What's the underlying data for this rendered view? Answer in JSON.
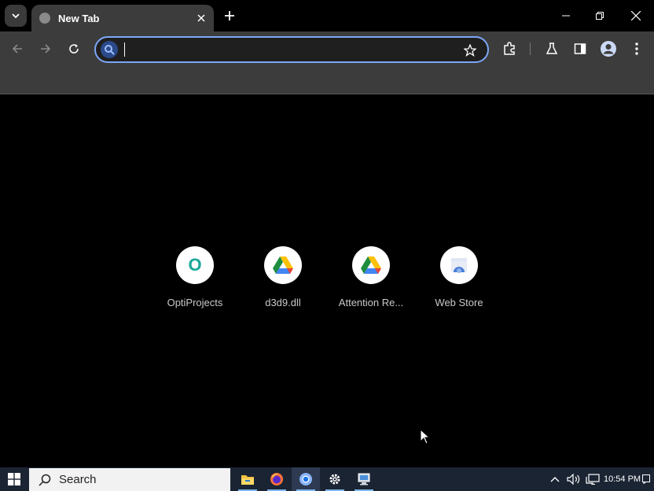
{
  "browser": {
    "tab": {
      "title": "New Tab"
    },
    "omnibox": {
      "value": "",
      "placeholder": ""
    }
  },
  "shortcuts": [
    {
      "label": "OptiProjects",
      "icon": "optiprojects-icon",
      "letter": "O"
    },
    {
      "label": "d3d9.dll",
      "icon": "google-drive-icon"
    },
    {
      "label": "Attention Re...",
      "icon": "google-drive-icon"
    },
    {
      "label": "Web Store",
      "icon": "web-store-icon"
    }
  ],
  "taskbar": {
    "search_label": "Search",
    "clock": "10:54 PM",
    "apps": [
      "file-explorer-icon",
      "firefox-icon",
      "chrome-icon",
      "settings-icon",
      "remote-desktop-icon"
    ]
  },
  "colors": {
    "accent": "#7da7f7",
    "tab_bg": "#3c3c3c",
    "taskbar_bg": "#1b2433"
  }
}
